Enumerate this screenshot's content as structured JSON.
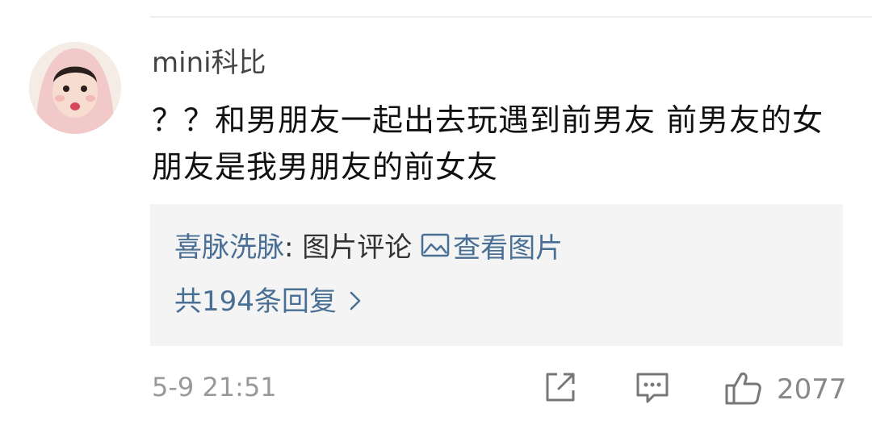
{
  "comment": {
    "username": "mini科比",
    "text": "？？和男朋友一起出去玩遇到前男友 前男友的女朋友是我男朋友的前女友",
    "reply_preview": {
      "user": "喜脉洗脉",
      "separator": ": ",
      "text": "图片评论",
      "view_image_label": "查看图片"
    },
    "reply_count_label": "共194条回复",
    "timestamp": "5-9 21:51",
    "like_count": "2077"
  },
  "icons": {
    "share": "share-icon",
    "comment": "comment-icon",
    "like": "thumbs-up-icon",
    "image": "image-icon",
    "chevron": "chevron-right-icon"
  },
  "colors": {
    "link": "#4a6f94",
    "reply_background": "#f4f4f4",
    "muted": "#999999"
  }
}
